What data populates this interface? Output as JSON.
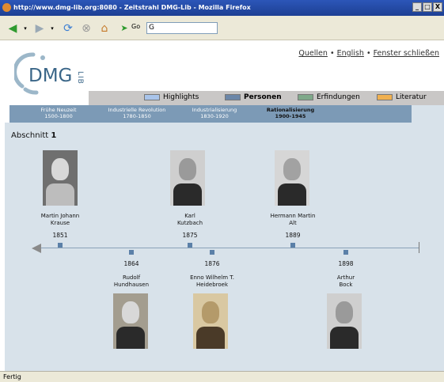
{
  "window": {
    "title": "http://www.dmg-lib.org:8080 - Zeitstrahl DMG-Lib - Mozilla Firefox",
    "controls": [
      "_",
      "□",
      "X"
    ]
  },
  "toolbar": {
    "go_label": "Go",
    "url_value": "G"
  },
  "header": {
    "logo_text": "DMG",
    "logo_sub": "LIB",
    "links": [
      "Quellen",
      "English",
      "Fenster schließen"
    ],
    "separator": "•"
  },
  "legend": [
    {
      "label": "Highlights",
      "color": "#a9c4ea",
      "active": false
    },
    {
      "label": "Personen",
      "color": "#6b86a8",
      "active": true
    },
    {
      "label": "Erfindungen",
      "color": "#7fa98a",
      "active": false
    },
    {
      "label": "Literatur",
      "color": "#f0b050",
      "active": false
    }
  ],
  "eras": [
    {
      "name": "Frühe Neuzeit",
      "range": "1500-1800",
      "active": false
    },
    {
      "name": "Industrielle Revolution",
      "range": "1780-1850",
      "active": false
    },
    {
      "name": "Industrialisierung",
      "range": "1830-1920",
      "active": false
    },
    {
      "name": "Rationalisierung",
      "range": "1900-1945",
      "active": true
    }
  ],
  "section": {
    "label": "Abschnitt",
    "number": "1"
  },
  "persons_top": [
    {
      "name": "Martin Johann\nKrause",
      "year": "1851"
    },
    {
      "name": "Karl\nKutzbach",
      "year": "1875"
    },
    {
      "name": "Hermann Martin\nAlt",
      "year": "1889"
    }
  ],
  "persons_bottom": [
    {
      "name": "Rudolf\nHundhausen",
      "year": "1864"
    },
    {
      "name": "Enno Wilhelm T.\nHeidebroek",
      "year": "1876"
    },
    {
      "name": "Arthur\nBock",
      "year": "1898"
    }
  ],
  "status": "Fertig"
}
